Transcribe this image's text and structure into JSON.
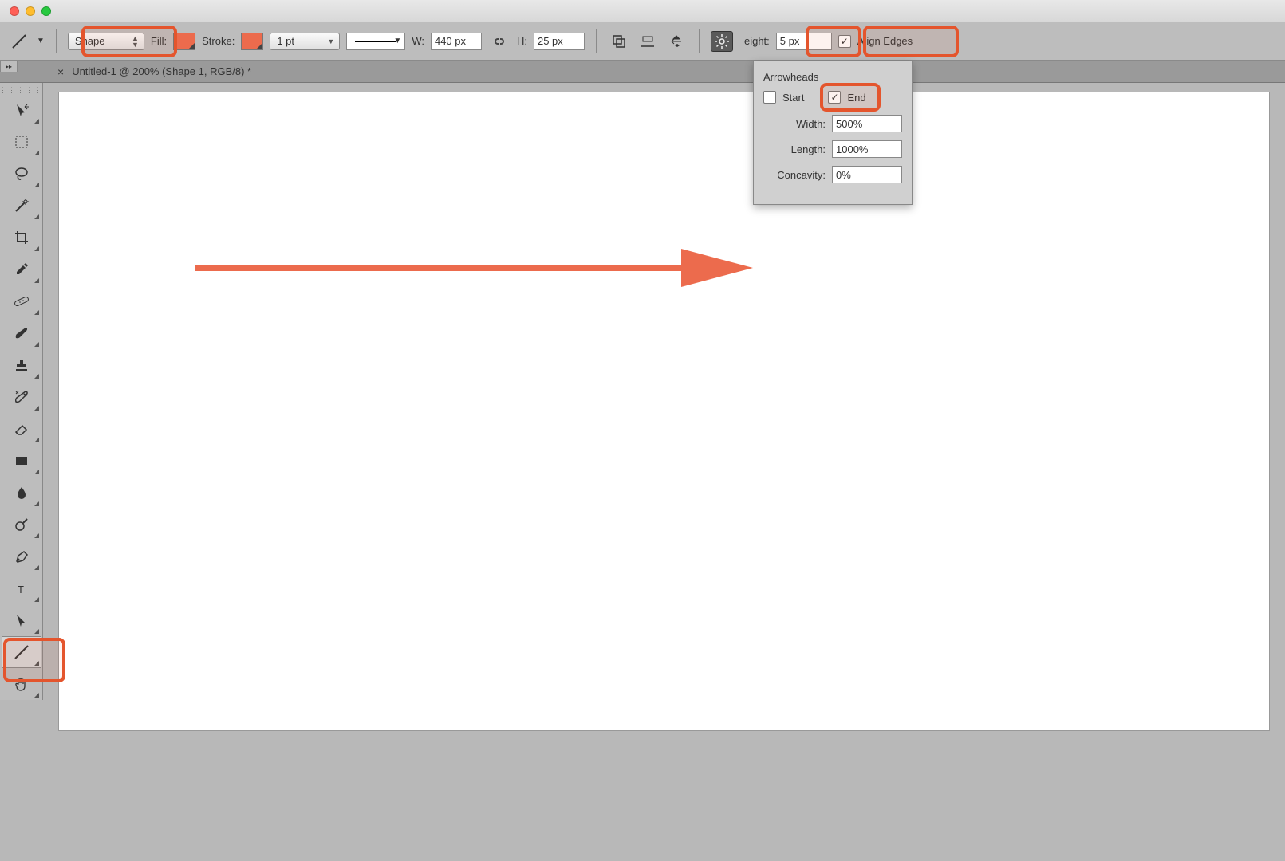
{
  "titlebar": {
    "close": "#ff5f56",
    "min": "#ffbd2e",
    "max": "#27c93f"
  },
  "options": {
    "mode": "Shape",
    "fill_label": "Fill:",
    "fill_color": "#ec6b4d",
    "stroke_label": "Stroke:",
    "stroke_color": "#ec6b4d",
    "stroke_weight": "1 pt",
    "w_label": "W:",
    "w_value": "440 px",
    "h_label": "H:",
    "h_value": "25 px",
    "weight_label": "eight:",
    "weight_value": "5 px",
    "align_label": "Align Edges"
  },
  "tab": {
    "title": "Untitled-1 @ 200% (Shape 1, RGB/8) *"
  },
  "popup": {
    "title": "Arrowheads",
    "start_label": "Start",
    "end_label": "End",
    "start_checked": false,
    "end_checked": true,
    "width_label": "Width:",
    "width_value": "500%",
    "length_label": "Length:",
    "length_value": "1000%",
    "concavity_label": "Concavity:",
    "concavity_value": "0%"
  },
  "tools": [
    {
      "name": "move-tool",
      "icon": "move",
      "sub": true
    },
    {
      "name": "marquee-tool",
      "icon": "marquee",
      "sub": true
    },
    {
      "name": "lasso-tool",
      "icon": "lasso",
      "sub": true
    },
    {
      "name": "quick-select-tool",
      "icon": "wand",
      "sub": true
    },
    {
      "name": "crop-tool",
      "icon": "crop",
      "sub": true
    },
    {
      "name": "eyedropper-tool",
      "icon": "eyedropper",
      "sub": true
    },
    {
      "name": "healing-tool",
      "icon": "bandage",
      "sub": true
    },
    {
      "name": "brush-tool",
      "icon": "brush",
      "sub": true
    },
    {
      "name": "stamp-tool",
      "icon": "stamp",
      "sub": true
    },
    {
      "name": "history-brush-tool",
      "icon": "history",
      "sub": true
    },
    {
      "name": "eraser-tool",
      "icon": "eraser",
      "sub": true
    },
    {
      "name": "gradient-tool",
      "icon": "gradient",
      "sub": true
    },
    {
      "name": "blur-tool",
      "icon": "drop",
      "sub": true
    },
    {
      "name": "dodge-tool",
      "icon": "dodge",
      "sub": true
    },
    {
      "name": "pen-tool",
      "icon": "pen",
      "sub": true
    },
    {
      "name": "text-tool",
      "icon": "text",
      "sub": true
    },
    {
      "name": "path-select-tool",
      "icon": "arrow",
      "sub": true
    },
    {
      "name": "line-tool",
      "icon": "line",
      "sub": true,
      "selected": true
    },
    {
      "name": "hand-tool",
      "icon": "hand",
      "sub": true
    }
  ]
}
